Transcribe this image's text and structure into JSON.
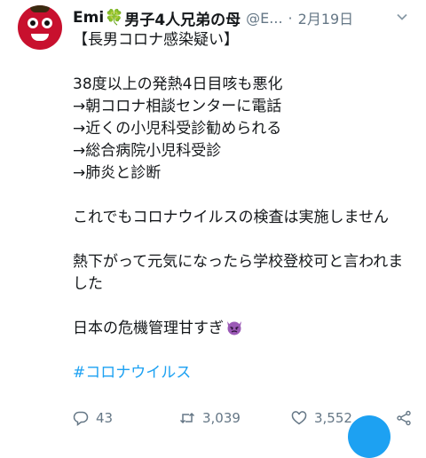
{
  "tweet": {
    "author_name": "Emi",
    "clover": "🍀",
    "author_name_suffix": "男子4人兄弟の母",
    "handle": "@E...",
    "separator": "·",
    "date": "2月19日",
    "lines": [
      "【長男コロナ感染疑い】",
      "",
      "38度以上の発熱4日目咳も悪化",
      "→朝コロナ相談センターに電話",
      "→近くの小児科受診勧められる",
      "→総合病院小児科受診",
      "→肺炎と診断",
      "",
      "これでもコロナウイルスの検査は実施しません",
      "",
      "熱下がって元気になったら学校登校可と言われました",
      "",
      "日本の危機管理甘すぎ"
    ],
    "hashtag": "#コロナウイルス",
    "replies": "43",
    "retweets": "3,039",
    "likes": "3,552"
  },
  "colors": {
    "accent": "#1da1f2",
    "muted": "#657786",
    "text": "#14171a"
  }
}
